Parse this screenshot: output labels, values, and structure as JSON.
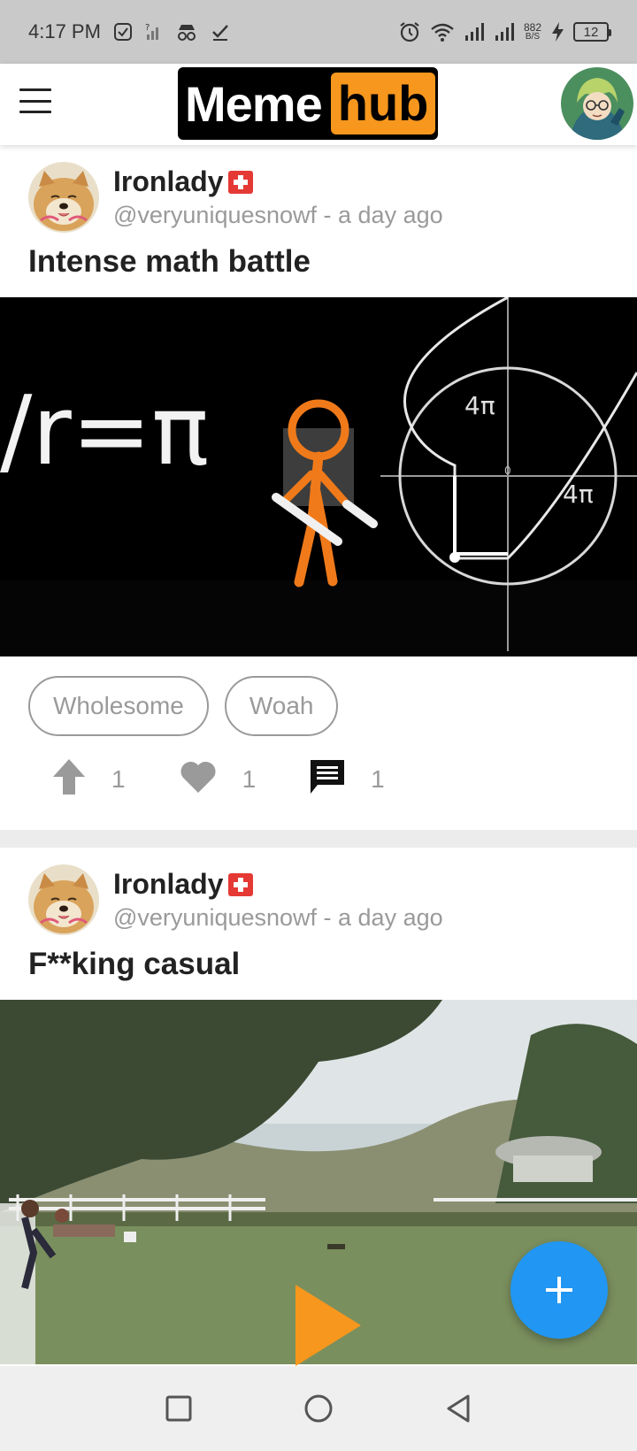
{
  "status_bar": {
    "time": "4:17 PM",
    "net_speed_value": "882",
    "net_speed_unit": "B/S",
    "battery": "12",
    "icons": [
      "checkbox-icon",
      "no-signal-icon",
      "incognito-icon",
      "checkmark-icon",
      "alarm-icon",
      "wifi-icon",
      "signal-icon",
      "signal-icon",
      "charging-icon",
      "battery-icon"
    ]
  },
  "header": {
    "logo_meme": "Meme",
    "logo_hub": "hub",
    "brand_color": "#f7971d",
    "icons": [
      "menu-icon",
      "profile-avatar"
    ]
  },
  "posts": [
    {
      "author": "Ironlady",
      "handle": "@veryuniquesnowf",
      "time": "a day ago",
      "subline": "@veryuniquesnowf - a day ago",
      "title": "Intense math battle",
      "media_text": {
        "equation": "/r=π",
        "label_top": "4π",
        "label_right": "4π",
        "label_origin": "0"
      },
      "tags": [
        "Wholesome",
        "Woah"
      ],
      "upvotes": "1",
      "likes": "1",
      "comments": "1"
    },
    {
      "author": "Ironlady",
      "handle": "@veryuniquesnowf",
      "time": "a day ago",
      "subline": "@veryuniquesnowf - a day ago",
      "title": "F**king casual"
    }
  ],
  "fab": {
    "label": "+",
    "color": "#2196f3"
  },
  "nav": {
    "icons": [
      "recents-icon",
      "home-icon",
      "back-icon"
    ]
  }
}
